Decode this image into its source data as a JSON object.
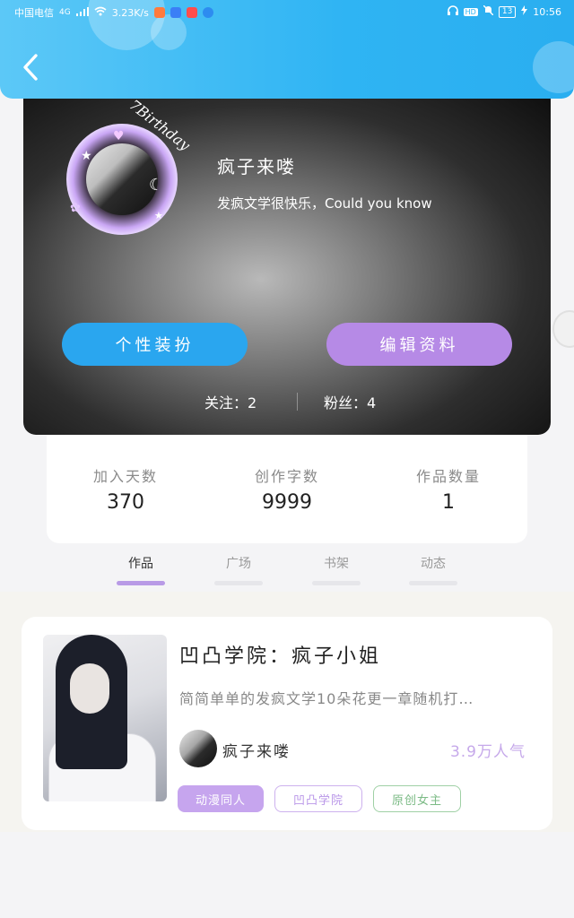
{
  "status_bar": {
    "carrier": "中国电信",
    "network": "4G",
    "speed": "3.23K/s",
    "battery": "13",
    "time": "10:56"
  },
  "profile": {
    "avatar_caption": "7Birthday",
    "username": "疯子来喽",
    "bio": "发疯文学很快乐，Could you know",
    "dress_button": "个性装扮",
    "edit_button": "编辑资料",
    "following_label": "关注：",
    "following_count": "2",
    "fans_label": "粉丝：",
    "fans_count": "4"
  },
  "stats": [
    {
      "label": "加入天数",
      "value": "370"
    },
    {
      "label": "创作字数",
      "value": "9999"
    },
    {
      "label": "作品数量",
      "value": "1"
    }
  ],
  "tabs": [
    {
      "label": "作品",
      "active": true
    },
    {
      "label": "广场",
      "active": false
    },
    {
      "label": "书架",
      "active": false
    },
    {
      "label": "动态",
      "active": false
    }
  ],
  "work": {
    "title": "凹凸学院：疯子小姐",
    "description": "简简单单的发疯文学10朵花更一章随机打…",
    "author": "疯子来喽",
    "popularity": "3.9万人气",
    "tags": [
      "动漫同人",
      "凹凸学院",
      "原创女主"
    ]
  },
  "colors": {
    "header_blue": "#2fb4f3",
    "dress_button": "#2aa6ef",
    "edit_button": "#b68ae6",
    "tab_active": "#b89ae6",
    "popularity": "#c6a9ea"
  }
}
